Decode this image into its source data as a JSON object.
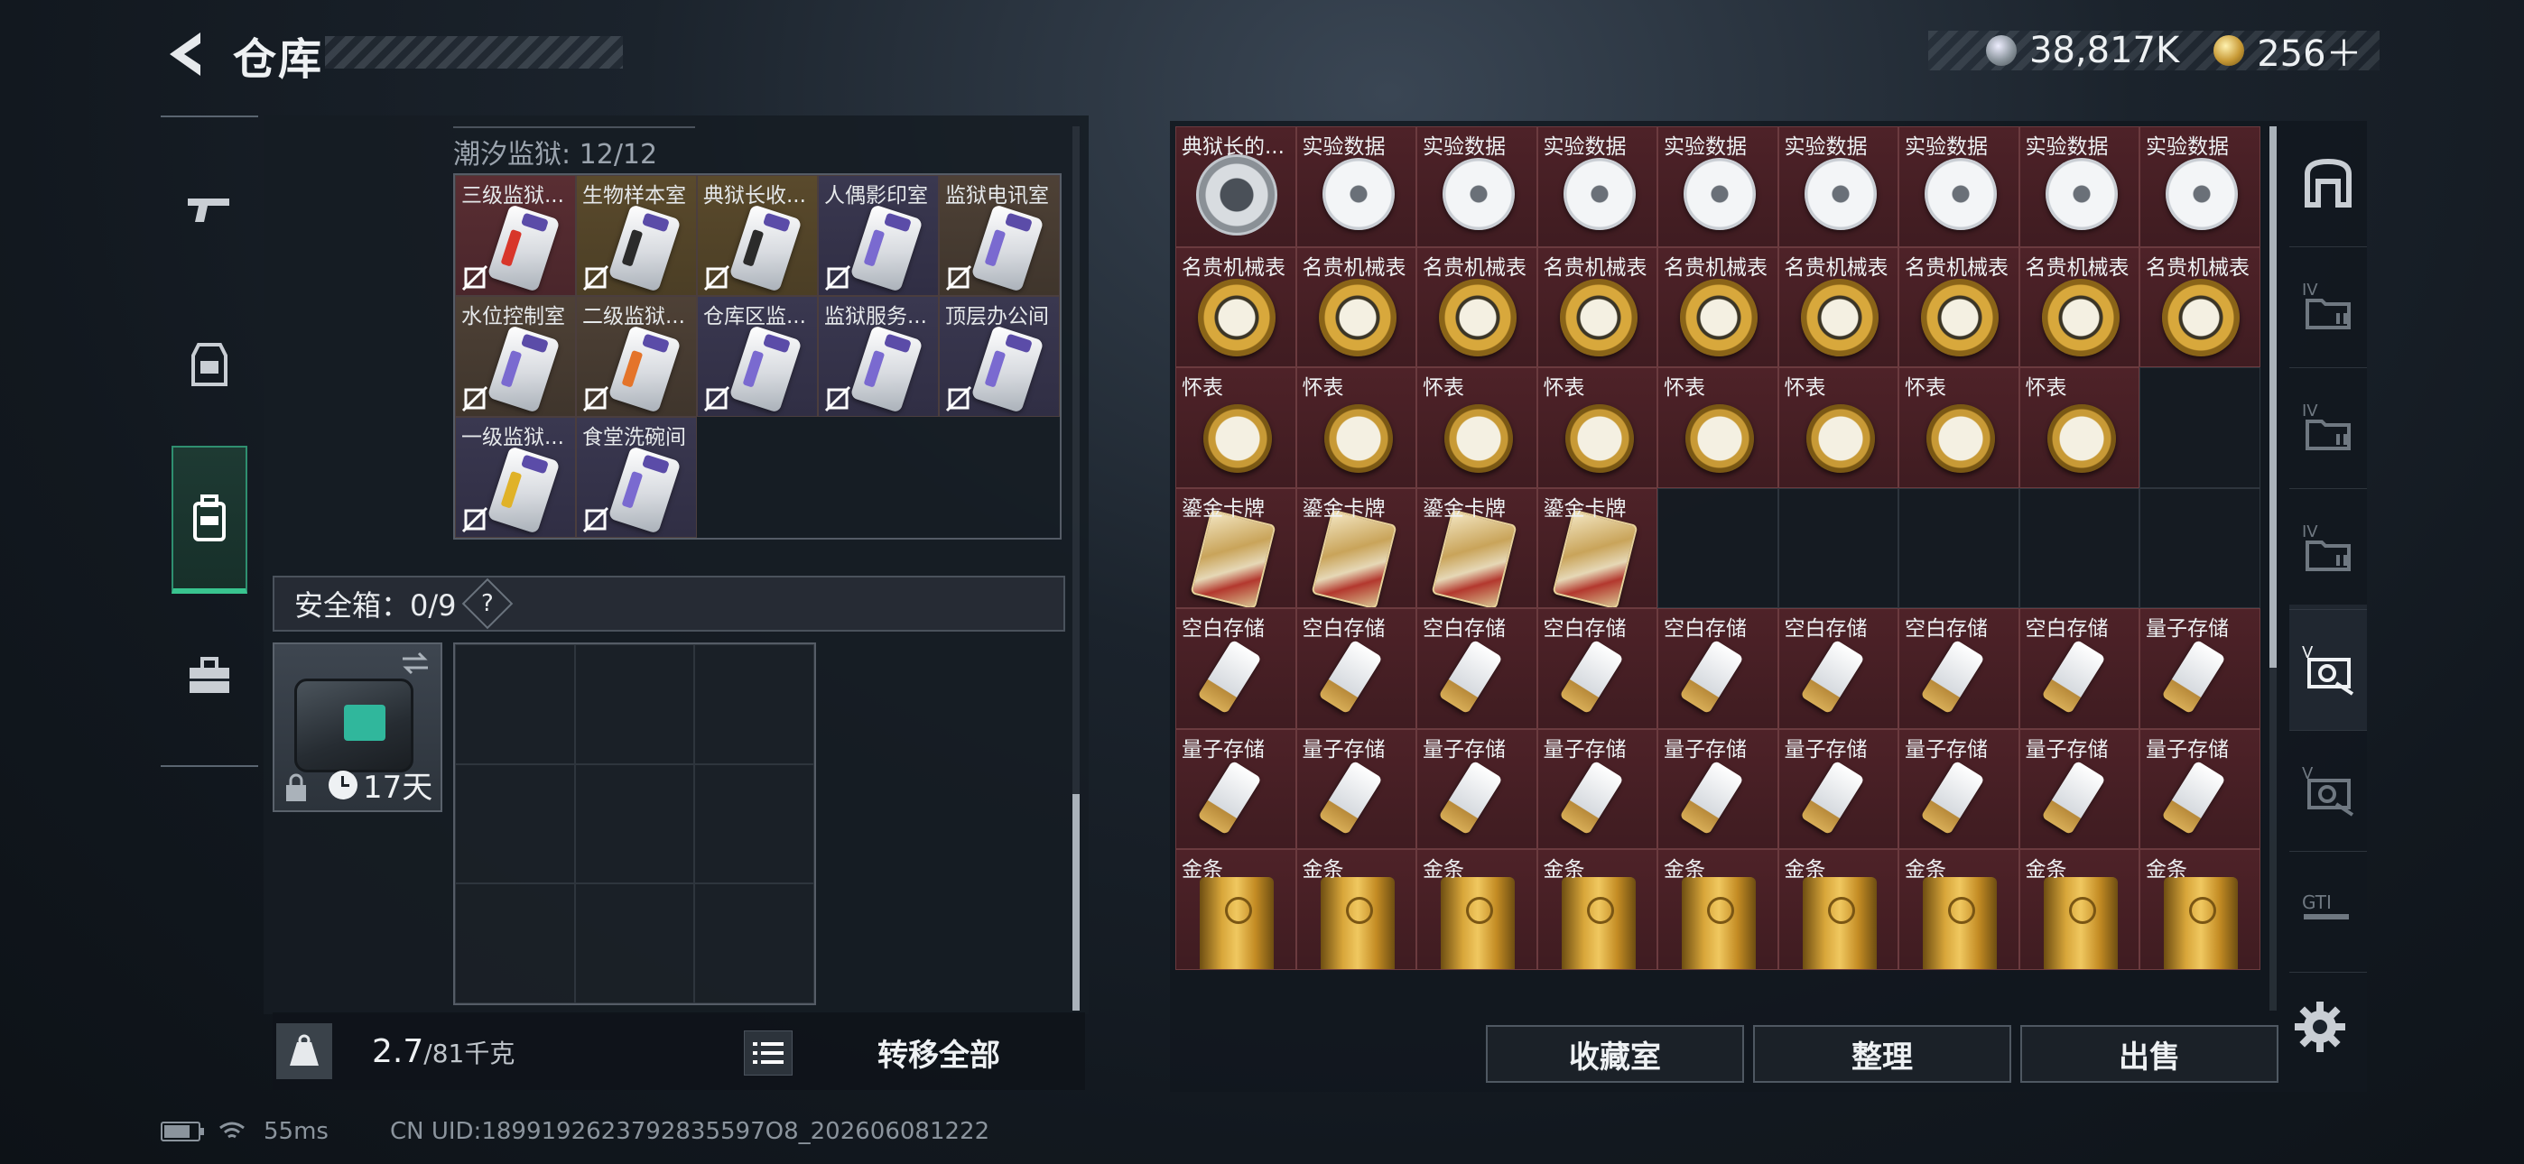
{
  "header": {
    "title": "仓库",
    "currency_silver": "38,817K",
    "currency_gold": "256＋"
  },
  "left_nav": [
    {
      "name": "weapons",
      "icon": "pistol-icon"
    },
    {
      "name": "armor",
      "icon": "armor-vest-icon"
    },
    {
      "name": "backpack",
      "icon": "backpack-icon",
      "active": true
    },
    {
      "name": "toolbox",
      "icon": "toolbox-icon"
    }
  ],
  "container": {
    "title": "潮汐监狱: 12/12",
    "items": [
      {
        "label": "三级监狱...",
        "bg": "red",
        "stripe": "#d8362a"
      },
      {
        "label": "生物样本室",
        "bg": "gold",
        "stripe": "#2b2b2b"
      },
      {
        "label": "典狱长收...",
        "bg": "gold",
        "stripe": "#2b2b2b"
      },
      {
        "label": "人偶影印室",
        "bg": "purple",
        "stripe": "#7a6ad0"
      },
      {
        "label": "监狱电讯室",
        "bg": "brown",
        "stripe": "#7a6ad0"
      },
      {
        "label": "水位控制室",
        "bg": "brown",
        "stripe": "#7a6ad0"
      },
      {
        "label": "二级监狱...",
        "bg": "brown",
        "stripe": "#e4742a"
      },
      {
        "label": "仓库区监...",
        "bg": "purple",
        "stripe": "#7a6ad0"
      },
      {
        "label": "监狱服务...",
        "bg": "purple",
        "stripe": "#7a6ad0"
      },
      {
        "label": "顶层办公间",
        "bg": "purple",
        "stripe": "#7a6ad0"
      },
      {
        "label": "一级监狱...",
        "bg": "purple",
        "stripe": "#e0b228"
      },
      {
        "label": "食堂洗碗间",
        "bg": "purple",
        "stripe": "#7a6ad0"
      }
    ]
  },
  "safebox": {
    "label": "安全箱：0/9",
    "help": "?",
    "days_left": "17天"
  },
  "weight": {
    "current": "2.7",
    "max": "/81千克",
    "transfer_all": "转移全部"
  },
  "warehouse": {
    "cells": [
      {
        "label": "典狱长的...",
        "art": "medal"
      },
      {
        "label": "实验数据",
        "art": "disc"
      },
      {
        "label": "实验数据",
        "art": "disc"
      },
      {
        "label": "实验数据",
        "art": "disc"
      },
      {
        "label": "实验数据",
        "art": "disc"
      },
      {
        "label": "实验数据",
        "art": "disc"
      },
      {
        "label": "实验数据",
        "art": "disc"
      },
      {
        "label": "实验数据",
        "art": "disc"
      },
      {
        "label": "实验数据",
        "art": "disc"
      },
      {
        "label": "名贵机械表",
        "art": "watch"
      },
      {
        "label": "名贵机械表",
        "art": "watch"
      },
      {
        "label": "名贵机械表",
        "art": "watch"
      },
      {
        "label": "名贵机械表",
        "art": "watch"
      },
      {
        "label": "名贵机械表",
        "art": "watch"
      },
      {
        "label": "名贵机械表",
        "art": "watch"
      },
      {
        "label": "名贵机械表",
        "art": "watch"
      },
      {
        "label": "名贵机械表",
        "art": "watch"
      },
      {
        "label": "名贵机械表",
        "art": "watch"
      },
      {
        "label": "怀表",
        "art": "pocket"
      },
      {
        "label": "怀表",
        "art": "pocket"
      },
      {
        "label": "怀表",
        "art": "pocket"
      },
      {
        "label": "怀表",
        "art": "pocket"
      },
      {
        "label": "怀表",
        "art": "pocket"
      },
      {
        "label": "怀表",
        "art": "pocket"
      },
      {
        "label": "怀表",
        "art": "pocket"
      },
      {
        "label": "怀表",
        "art": "pocket"
      },
      {
        "label": "",
        "art": "empty"
      },
      {
        "label": "鎏金卡牌",
        "art": "card"
      },
      {
        "label": "鎏金卡牌",
        "art": "card"
      },
      {
        "label": "鎏金卡牌",
        "art": "card"
      },
      {
        "label": "鎏金卡牌",
        "art": "card"
      },
      {
        "label": "",
        "art": "empty"
      },
      {
        "label": "",
        "art": "empty"
      },
      {
        "label": "",
        "art": "empty"
      },
      {
        "label": "",
        "art": "empty"
      },
      {
        "label": "",
        "art": "empty"
      },
      {
        "label": "空白存储",
        "art": "usb"
      },
      {
        "label": "空白存储",
        "art": "usb"
      },
      {
        "label": "空白存储",
        "art": "usb"
      },
      {
        "label": "空白存储",
        "art": "usb"
      },
      {
        "label": "空白存储",
        "art": "usb"
      },
      {
        "label": "空白存储",
        "art": "usb"
      },
      {
        "label": "空白存储",
        "art": "usb"
      },
      {
        "label": "空白存储",
        "art": "usb"
      },
      {
        "label": "量子存储",
        "art": "usb"
      },
      {
        "label": "量子存储",
        "art": "usb"
      },
      {
        "label": "量子存储",
        "art": "usb"
      },
      {
        "label": "量子存储",
        "art": "usb"
      },
      {
        "label": "量子存储",
        "art": "usb"
      },
      {
        "label": "量子存储",
        "art": "usb"
      },
      {
        "label": "量子存储",
        "art": "usb"
      },
      {
        "label": "量子存储",
        "art": "usb"
      },
      {
        "label": "量子存储",
        "art": "usb"
      },
      {
        "label": "量子存储",
        "art": "usb"
      },
      {
        "label": "金条",
        "art": "bar"
      },
      {
        "label": "金条",
        "art": "bar"
      },
      {
        "label": "金条",
        "art": "bar"
      },
      {
        "label": "金条",
        "art": "bar"
      },
      {
        "label": "金条",
        "art": "bar"
      },
      {
        "label": "金条",
        "art": "bar"
      },
      {
        "label": "金条",
        "art": "bar"
      },
      {
        "label": "金条",
        "art": "bar"
      },
      {
        "label": "金条",
        "art": "bar"
      }
    ],
    "actions": {
      "collection": "收藏室",
      "sort": "整理",
      "sell": "出售"
    }
  },
  "right_rail": [
    {
      "name": "vault",
      "icon": "vault-door-icon"
    },
    {
      "name": "folder-iv-1",
      "icon": "folder-iv-icon",
      "tag": "IV"
    },
    {
      "name": "folder-iv-2",
      "icon": "folder-iv-icon",
      "tag": "IV"
    },
    {
      "name": "folder-iv-3",
      "icon": "folder-iv-icon",
      "tag": "IV"
    },
    {
      "name": "vehicle-v-1",
      "icon": "vehicle-v-icon",
      "tag": "V",
      "active": true
    },
    {
      "name": "vehicle-v-2",
      "icon": "vehicle-v-icon",
      "tag": "V"
    },
    {
      "name": "gti",
      "icon": "gti-icon",
      "tag": "GTI"
    }
  ],
  "footer": {
    "ping": "55ms",
    "uid": "CN UID:1899192623792835597О8_202606081222"
  },
  "colors": {
    "accent_green": "#39c48f",
    "item_red": "#4e2228"
  }
}
